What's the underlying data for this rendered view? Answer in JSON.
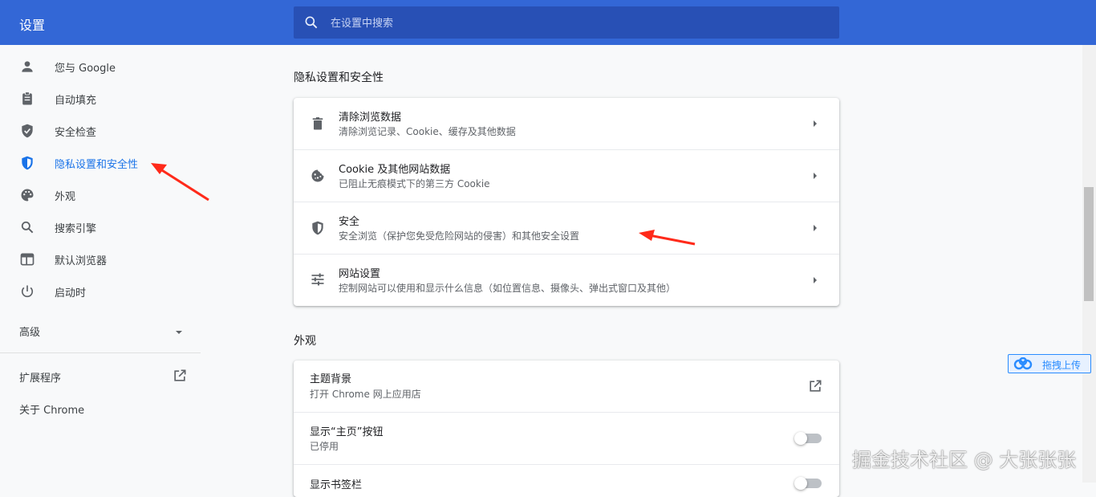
{
  "header": {
    "title": "设置",
    "search_placeholder": "在设置中搜索"
  },
  "sidebar": {
    "items": [
      {
        "label": "您与 Google",
        "icon": "person-icon"
      },
      {
        "label": "自动填充",
        "icon": "clipboard-icon"
      },
      {
        "label": "安全检查",
        "icon": "shield-check-icon"
      },
      {
        "label": "隐私设置和安全性",
        "icon": "shield-half-icon",
        "active": true
      },
      {
        "label": "外观",
        "icon": "palette-icon"
      },
      {
        "label": "搜索引擎",
        "icon": "search-icon"
      },
      {
        "label": "默认浏览器",
        "icon": "browser-window-icon"
      },
      {
        "label": "启动时",
        "icon": "power-icon"
      }
    ],
    "advanced_label": "高级",
    "extensions_label": "扩展程序",
    "about_label": "关于 Chrome"
  },
  "main": {
    "privacy": {
      "title": "隐私设置和安全性",
      "rows": [
        {
          "title": "清除浏览数据",
          "subtitle": "清除浏览记录、Cookie、缓存及其他数据",
          "icon": "trash-icon"
        },
        {
          "title": "Cookie 及其他网站数据",
          "subtitle": "已阻止无痕模式下的第三方 Cookie",
          "icon": "cookie-icon"
        },
        {
          "title": "安全",
          "subtitle": "安全浏览（保护您免受危险网站的侵害）和其他安全设置",
          "icon": "shield-half-icon"
        },
        {
          "title": "网站设置",
          "subtitle": "控制网站可以使用和显示什么信息（如位置信息、摄像头、弹出式窗口及其他）",
          "icon": "sliders-icon"
        }
      ]
    },
    "appearance": {
      "title": "外观",
      "rows": [
        {
          "title": "主题背景",
          "subtitle": "打开 Chrome 网上应用店"
        },
        {
          "title": "显示“主页”按钮",
          "subtitle": "已停用",
          "toggle": false
        },
        {
          "title": "显示书签栏",
          "toggle": false
        }
      ]
    }
  },
  "upload_widget": {
    "label": "拖拽上传"
  },
  "watermark": "掘金技术社区 @ 大张张张",
  "colors": {
    "header": "#3367d6",
    "accent": "#1a73e8",
    "annotation": "#ff2a1a"
  }
}
